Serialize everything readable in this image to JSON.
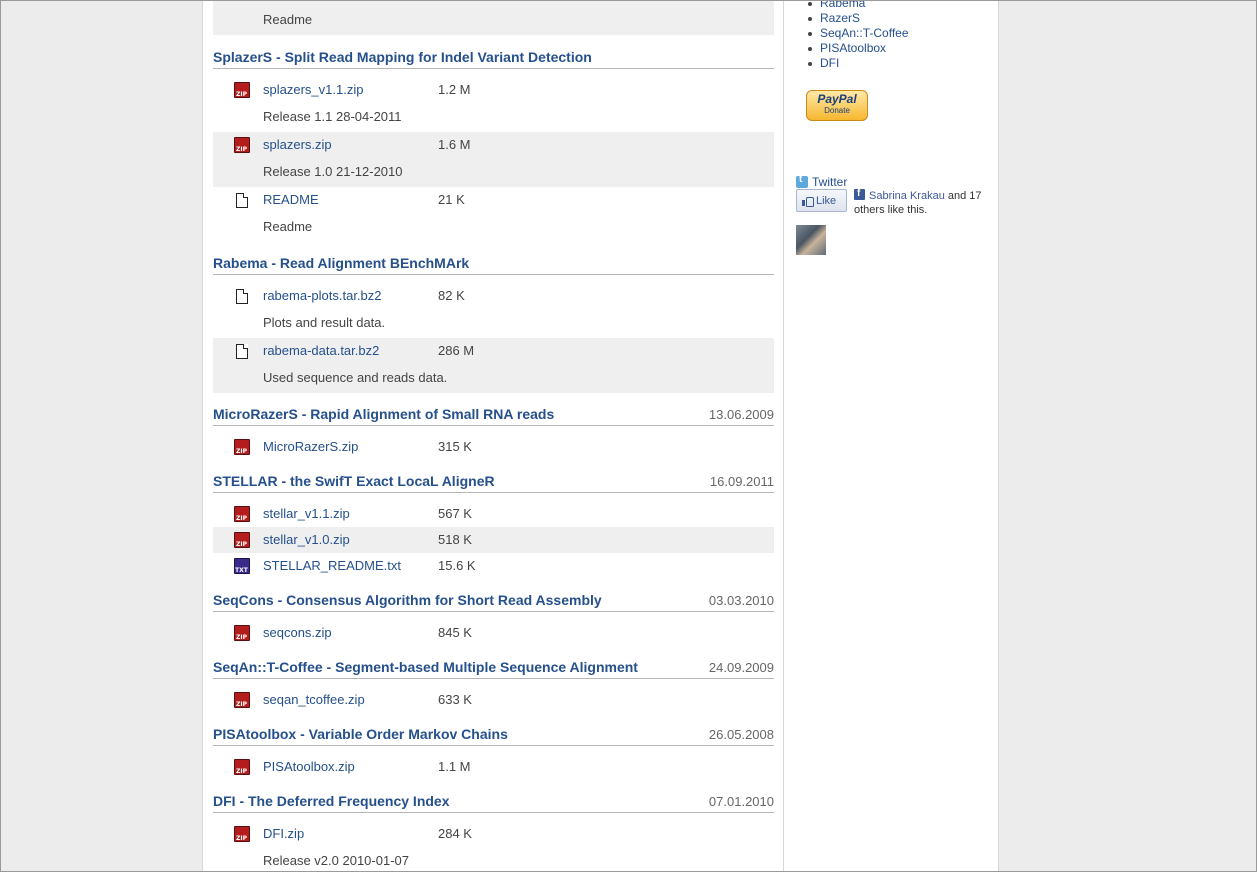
{
  "sections": [
    {
      "title": "",
      "date": "",
      "files": [
        {
          "name": "",
          "size": "",
          "icon": "doc",
          "desc": "Readme",
          "alt": true
        }
      ]
    },
    {
      "title": "SplazerS - Split Read Mapping for Indel Variant Detection",
      "date": "",
      "files": [
        {
          "name": "splazers_v1.1.zip",
          "size": "1.2 M",
          "icon": "zip",
          "desc": "Release 1.1 28-04-2011",
          "alt": false
        },
        {
          "name": "splazers.zip",
          "size": "1.6 M",
          "icon": "zip",
          "desc": "Release 1.0 21-12-2010",
          "alt": true
        },
        {
          "name": "README",
          "size": "21 K",
          "icon": "doc",
          "desc": "Readme",
          "alt": false
        }
      ]
    },
    {
      "title": "Rabema - Read Alignment BEnchMArk",
      "date": "",
      "files": [
        {
          "name": "rabema-plots.tar.bz2",
          "size": "82 K",
          "icon": "doc",
          "desc": "Plots and result data.",
          "alt": false
        },
        {
          "name": "rabema-data.tar.bz2",
          "size": "286 M",
          "icon": "doc",
          "desc": "Used sequence and reads data.",
          "alt": true
        }
      ]
    },
    {
      "title": "MicroRazerS - Rapid Alignment of Small RNA reads",
      "date": "13.06.2009",
      "files": [
        {
          "name": "MicroRazerS.zip",
          "size": "315 K",
          "icon": "zip",
          "desc": "",
          "alt": false
        }
      ]
    },
    {
      "title": "STELLAR - the SwifT Exact LocaL AligneR",
      "date": "16.09.2011",
      "files": [
        {
          "name": "stellar_v1.1.zip",
          "size": "567 K",
          "icon": "zip",
          "desc": "",
          "alt": false
        },
        {
          "name": "stellar_v1.0.zip",
          "size": "518 K",
          "icon": "zip",
          "desc": "",
          "alt": true
        },
        {
          "name": "STELLAR_README.txt",
          "size": "15.6 K",
          "icon": "txt",
          "desc": "",
          "alt": false
        }
      ]
    },
    {
      "title": "SeqCons - Consensus Algorithm for Short Read Assembly",
      "date": "03.03.2010",
      "files": [
        {
          "name": "seqcons.zip",
          "size": "845 K",
          "icon": "zip",
          "desc": "",
          "alt": false
        }
      ]
    },
    {
      "title": "SeqAn::T-Coffee - Segment-based Multiple Sequence Alignment",
      "date": "24.09.2009",
      "files": [
        {
          "name": "seqan_tcoffee.zip",
          "size": "633 K",
          "icon": "zip",
          "desc": "",
          "alt": false
        }
      ]
    },
    {
      "title": "PISAtoolbox - Variable Order Markov Chains",
      "date": "26.05.2008",
      "files": [
        {
          "name": "PISAtoolbox.zip",
          "size": "1.1 M",
          "icon": "zip",
          "desc": "",
          "alt": false
        }
      ]
    },
    {
      "title": "DFI - The Deferred Frequency Index",
      "date": "07.01.2010",
      "files": [
        {
          "name": "DFI.zip",
          "size": "284 K",
          "icon": "zip",
          "desc": "Release v2.0 2010-01-07",
          "alt": false
        }
      ]
    }
  ],
  "sidebar": {
    "links": [
      "Rabema",
      "RazerS",
      "SeqAn::T-Coffee",
      "PISAtoolbox",
      "DFI"
    ],
    "paypal": {
      "brand": "PayPal",
      "sub": "Donate"
    },
    "twitter_label": "Twitter",
    "like_label": "Like",
    "like_name": "Sabrina Krakau",
    "like_rest": " and 17 others like this."
  },
  "colors": {
    "link": "#25508c",
    "alt_row": "#efefef",
    "rule": "#b5b5b5"
  }
}
